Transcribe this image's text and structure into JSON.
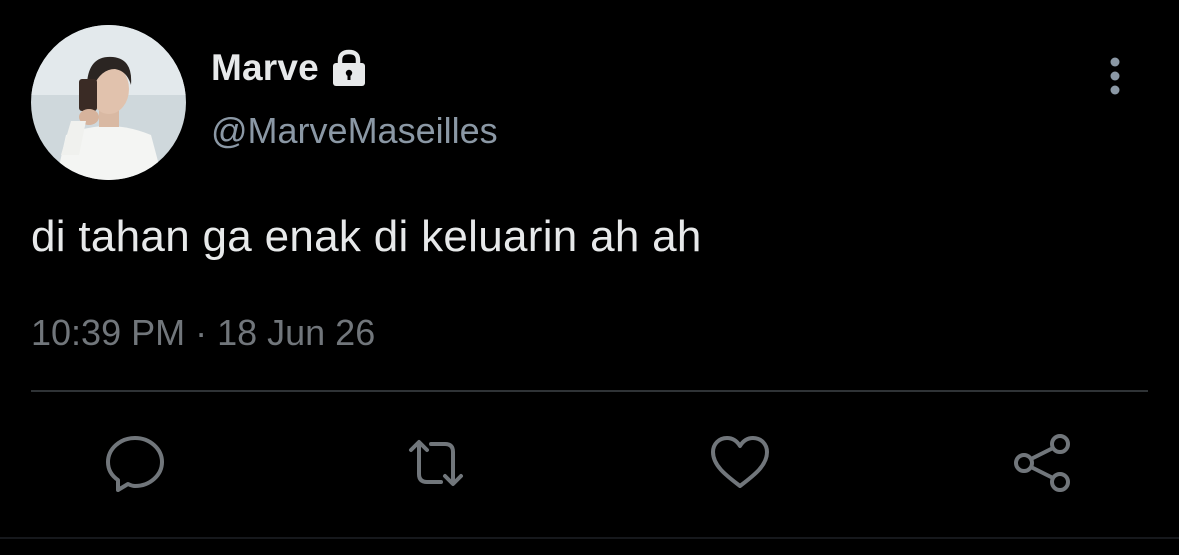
{
  "user": {
    "display_name": "Marve",
    "handle": "@MarveMaseilles",
    "protected_icon": "lock-icon",
    "avatar": "profile-photo"
  },
  "tweet": {
    "text": "di tahan ga enak di keluarin ah ah",
    "timestamp": "10:39 PM · 18 Jun 26"
  },
  "actions": {
    "reply_icon": "speech-bubble-icon",
    "retweet_icon": "retweet-icon",
    "like_icon": "heart-icon",
    "share_icon": "share-icon",
    "more_icon": "vertical-ellipsis-icon"
  },
  "colors": {
    "background": "#000000",
    "primary_text": "#e7e9ea",
    "secondary_text": "#71767b",
    "handle_text": "#8b98a5",
    "icon": "#71767b",
    "divider": "#2f3336"
  }
}
